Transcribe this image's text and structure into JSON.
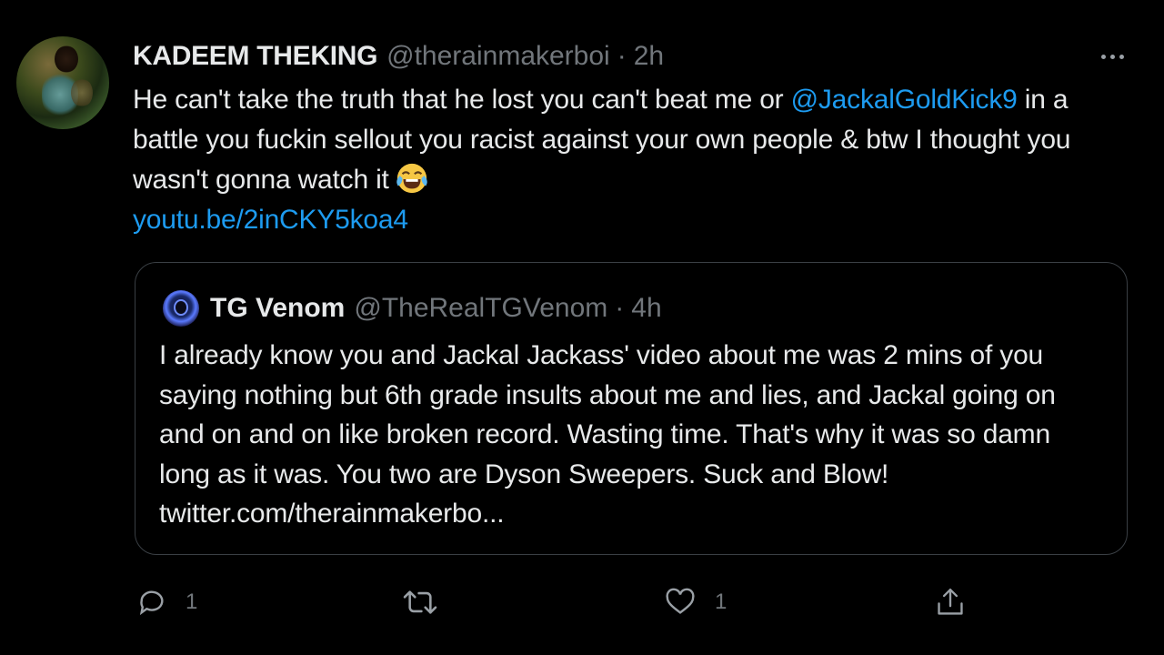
{
  "tweet": {
    "author_name": "KADEEM THEKING",
    "author_handle": "@therainmakerboi",
    "separator": "·",
    "time": "2h",
    "text_before_mention": "He can't take the truth that he lost you can't beat me or ",
    "mention": "@JackalGoldKick9",
    "text_after_mention": " in a battle you fuckin sellout you racist against your own people & btw I thought you wasn't gonna watch it",
    "emoji": "face-with-tears-of-joy",
    "link": "youtu.be/2inCKY5koa4"
  },
  "quoted_tweet": {
    "author_name": "TG Venom",
    "author_handle": "@TheRealTGVenom",
    "separator": "·",
    "time": "4h",
    "text": "I already know you and Jackal Jackass' video about me was 2 mins of you saying nothing but 6th grade insults about me and lies, and Jackal going on and on and on like broken record. Wasting time. That's why it was so damn long as it was. You two are Dyson Sweepers. Suck and Blow! twitter.com/therainmakerbo..."
  },
  "actions": {
    "reply_count": "1",
    "retweet_count": "",
    "like_count": "1"
  },
  "colors": {
    "background": "#000000",
    "text": "#e7e9ea",
    "muted": "#71767b",
    "link": "#1d9bf0",
    "border": "#3a3f44"
  },
  "icons": [
    "more-icon",
    "reply-icon",
    "retweet-icon",
    "like-icon",
    "share-icon"
  ]
}
